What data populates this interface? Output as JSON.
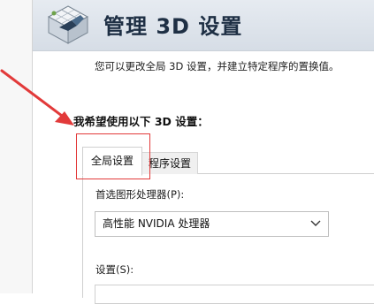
{
  "header": {
    "title": "管理 3D 设置",
    "icon": "nvidia-3d-settings-icon"
  },
  "main": {
    "description": "您可以更改全局 3D 设置，并建立特定程序的置换值。",
    "section_label": "我希望使用以下 3D 设置："
  },
  "tabs": [
    {
      "label": "全局设置",
      "active": true
    },
    {
      "label": "程序设置",
      "active": false
    }
  ],
  "gpu": {
    "label": "首选图形处理器(P):",
    "selected": "高性能 NVIDIA 处理器"
  },
  "settings": {
    "label": "设置(S):"
  },
  "annotations": {
    "color": "#e23a3a"
  }
}
